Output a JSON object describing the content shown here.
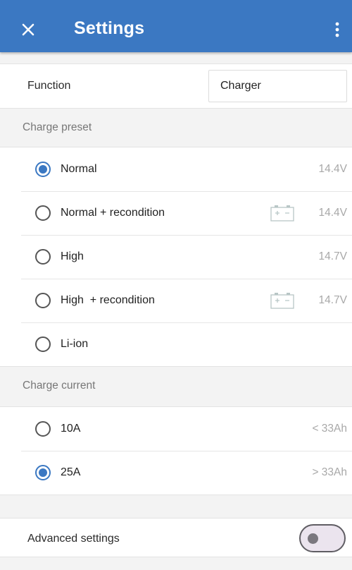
{
  "header": {
    "title": "Settings",
    "close_icon": "close-icon",
    "menu_icon": "more-vertical-icon",
    "bar_color": "#3b78c2"
  },
  "function": {
    "label": "Function",
    "value": "Charger"
  },
  "charge_preset": {
    "header": "Charge preset",
    "options": [
      {
        "label": "Normal",
        "value": "14.4V",
        "selected": true,
        "icon": ""
      },
      {
        "label": "Normal + recondition",
        "value": "14.4V",
        "selected": false,
        "icon": "battery-icon"
      },
      {
        "label": "High",
        "value": "14.7V",
        "selected": false,
        "icon": ""
      },
      {
        "label": "High  + recondition",
        "value": "14.7V",
        "selected": false,
        "icon": "battery-icon"
      },
      {
        "label": "Li-ion",
        "value": "",
        "selected": false,
        "icon": ""
      }
    ]
  },
  "charge_current": {
    "header": "Charge current",
    "options": [
      {
        "label": "10A",
        "value": "< 33Ah",
        "selected": false
      },
      {
        "label": "25A",
        "value": "> 33Ah",
        "selected": true
      }
    ]
  },
  "advanced": {
    "label": "Advanced settings",
    "enabled": false
  },
  "colors": {
    "accent": "#3b78c2",
    "secondary_text": "#a8a8a8"
  }
}
